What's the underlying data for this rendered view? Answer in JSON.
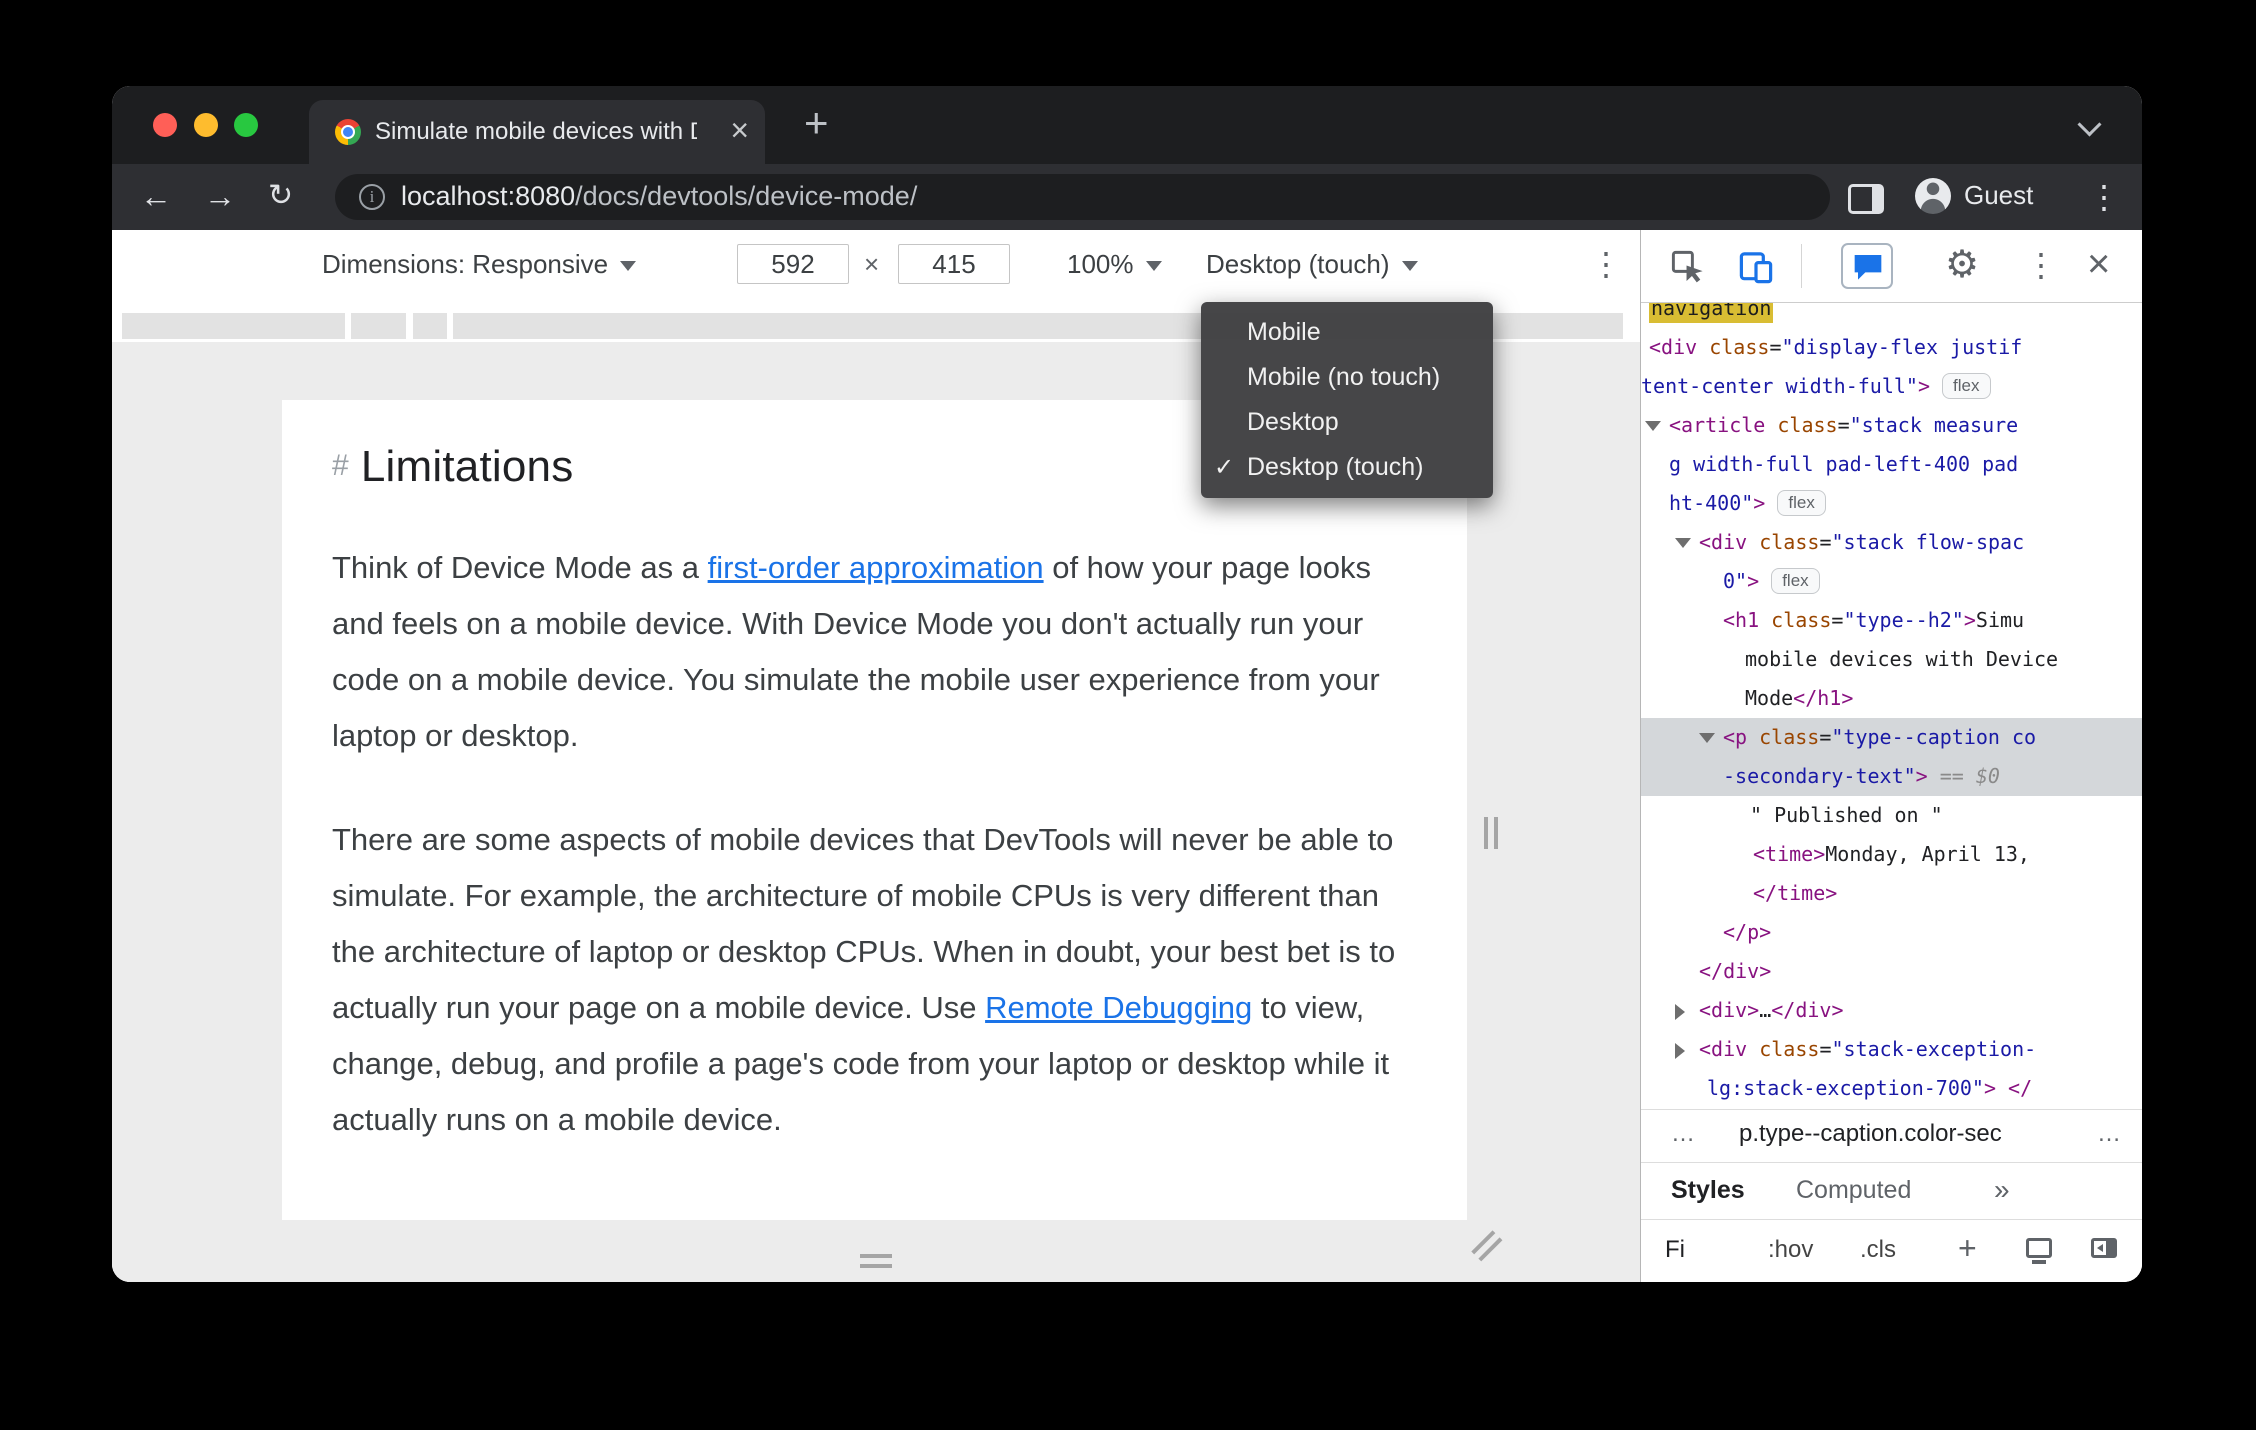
{
  "tabbar": {
    "tab_title": "Simulate mobile devices with D",
    "close_glyph": "×",
    "new_tab_glyph": "+"
  },
  "navbar": {
    "back_glyph": "←",
    "forward_glyph": "→",
    "reload_glyph": "↻",
    "info_glyph": "i",
    "url_host": "localhost:8080",
    "url_path": "/docs/devtools/device-mode/",
    "guest_label": "Guest",
    "menu_glyph": "⋮"
  },
  "device_toolbar": {
    "dimensions_label": "Dimensions: Responsive",
    "width_value": "592",
    "times_glyph": "×",
    "height_value": "415",
    "zoom_value": "100%",
    "device_type_value": "Desktop (touch)",
    "more_glyph": "⋮"
  },
  "device_menu": {
    "check_glyph": "✓",
    "items": [
      {
        "label": "Mobile",
        "checked": false
      },
      {
        "label": "Mobile (no touch)",
        "checked": false
      },
      {
        "label": "Desktop",
        "checked": false
      },
      {
        "label": "Desktop (touch)",
        "checked": true
      }
    ]
  },
  "page": {
    "heading_hash": "#",
    "heading": "Limitations",
    "para1": [
      {
        "t": "Think of Device Mode as a "
      },
      {
        "t": "first-order approximation",
        "link": true
      },
      {
        "t": " of how your page looks and feels on a mobile device. With Device Mode you don't actually run your code on a mobile device. You simulate the mobile user experience from your laptop or desktop."
      }
    ],
    "para2": [
      {
        "t": "There are some aspects of mobile devices that DevTools will never be able to simulate. For example, the architecture of mobile CPUs is very different than the architecture of laptop or desktop CPUs. When in doubt, your best bet is to actually run your page on a mobile device. Use "
      },
      {
        "t": "Remote Debugging",
        "link": true
      },
      {
        "t": " to view, change, debug, and profile a page's code from your laptop or desktop while it actually runs on a mobile device."
      }
    ]
  },
  "devtools": {
    "toolbar": {
      "gear_glyph": "⚙",
      "more_glyph": "⋮",
      "close_glyph": "×"
    },
    "tree": {
      "lines": [
        {
          "pad": 8,
          "clip": true,
          "segments": [
            {
              "t": "navigation",
              "c": "hl"
            }
          ]
        },
        {
          "pad": 8,
          "segments": [
            {
              "t": "<div ",
              "c": "tag"
            },
            {
              "t": "class",
              "c": "attr"
            },
            {
              "t": "=",
              "c": "text"
            },
            {
              "t": "\"display-flex justif",
              "c": "val"
            }
          ]
        },
        {
          "pad": 0,
          "segments": [
            {
              "t": "tent-center width-full\"",
              "c": "val"
            },
            {
              "t": ">",
              "c": "tag"
            },
            {
              "t": " ",
              "c": "text"
            },
            {
              "t": "flex",
              "c": "badge"
            }
          ]
        },
        {
          "pad": 28,
          "arrow": "down",
          "segments": [
            {
              "t": "<article ",
              "c": "tag"
            },
            {
              "t": "class",
              "c": "attr"
            },
            {
              "t": "=",
              "c": "text"
            },
            {
              "t": "\"stack measure",
              "c": "val"
            }
          ]
        },
        {
          "pad": 28,
          "segments": [
            {
              "t": "g width-full pad-left-400 pad",
              "c": "val"
            }
          ]
        },
        {
          "pad": 28,
          "segments": [
            {
              "t": "ht-400\"",
              "c": "val"
            },
            {
              "t": ">",
              "c": "tag"
            },
            {
              "t": " ",
              "c": "text"
            },
            {
              "t": "flex",
              "c": "badge"
            }
          ]
        },
        {
          "pad": 58,
          "arrow": "down",
          "segments": [
            {
              "t": "<div ",
              "c": "tag"
            },
            {
              "t": "class",
              "c": "attr"
            },
            {
              "t": "=",
              "c": "text"
            },
            {
              "t": "\"stack flow-spac",
              "c": "val"
            }
          ]
        },
        {
          "pad": 82,
          "segments": [
            {
              "t": "0\"",
              "c": "val"
            },
            {
              "t": ">",
              "c": "tag"
            },
            {
              "t": " ",
              "c": "text"
            },
            {
              "t": "flex",
              "c": "badge"
            }
          ]
        },
        {
          "pad": 82,
          "segments": [
            {
              "t": "<h1 ",
              "c": "tag"
            },
            {
              "t": "class",
              "c": "attr"
            },
            {
              "t": "=",
              "c": "text"
            },
            {
              "t": "\"type--h2\"",
              "c": "val"
            },
            {
              "t": ">",
              "c": "tag"
            },
            {
              "t": "Simu",
              "c": "text"
            }
          ]
        },
        {
          "pad": 104,
          "segments": [
            {
              "t": "mobile devices with Device",
              "c": "text"
            }
          ]
        },
        {
          "pad": 104,
          "segments": [
            {
              "t": "Mode",
              "c": "text"
            },
            {
              "t": "</h1>",
              "c": "tag"
            }
          ]
        },
        {
          "pad": 82,
          "arrow": "down",
          "selected": true,
          "segments": [
            {
              "t": "<p ",
              "c": "tag"
            },
            {
              "t": "class",
              "c": "attr"
            },
            {
              "t": "=",
              "c": "text"
            },
            {
              "t": "\"type--caption co",
              "c": "val"
            }
          ]
        },
        {
          "pad": 82,
          "selected": true,
          "segments": [
            {
              "t": "-secondary-text\"",
              "c": "val"
            },
            {
              "t": ">",
              "c": "tag"
            },
            {
              "t": " ",
              "c": "text"
            },
            {
              "t": "== ",
              "c": "eq"
            },
            {
              "t": "$0",
              "c": "dol"
            }
          ]
        },
        {
          "pad": 109,
          "segments": [
            {
              "t": "\" Published on \"",
              "c": "text"
            }
          ]
        },
        {
          "pad": 112,
          "segments": [
            {
              "t": "<time>",
              "c": "tag"
            },
            {
              "t": "Monday, April 13,",
              "c": "text"
            }
          ]
        },
        {
          "pad": 112,
          "segments": [
            {
              "t": "</time>",
              "c": "tag"
            }
          ]
        },
        {
          "pad": 82,
          "segments": [
            {
              "t": "</p>",
              "c": "tag"
            }
          ]
        },
        {
          "pad": 58,
          "segments": [
            {
              "t": "</div>",
              "c": "tag"
            }
          ]
        },
        {
          "pad": 58,
          "arrow": "right",
          "segments": [
            {
              "t": "<div>",
              "c": "tag"
            },
            {
              "t": "…",
              "c": "text"
            },
            {
              "t": "</div>",
              "c": "tag"
            }
          ]
        },
        {
          "pad": 58,
          "arrow": "right",
          "segments": [
            {
              "t": "<div ",
              "c": "tag"
            },
            {
              "t": "class",
              "c": "attr"
            },
            {
              "t": "=",
              "c": "text"
            },
            {
              "t": "\"stack-exception-",
              "c": "val"
            }
          ]
        },
        {
          "pad": 66,
          "segments": [
            {
              "t": "lg:stack-exception-700\"",
              "c": "val"
            },
            {
              "t": "> ",
              "c": "tag"
            },
            {
              "t": "</",
              "c": "tag"
            }
          ]
        }
      ]
    },
    "crumbs": {
      "overflow_left": "…",
      "selected": "p.type--caption.color-sec",
      "overflow_right": "…"
    },
    "tabs": {
      "styles": "Styles",
      "computed": "Computed",
      "more": "»"
    },
    "filter": {
      "value": "Fi",
      "hov": ":hov",
      "cls": ".cls",
      "add": "+"
    }
  },
  "colors": {
    "accent_blue": "#1a73e8",
    "tag": "#881280",
    "attr_name": "#994500",
    "attr_value": "#1a1aa6",
    "selection_gray": "#d4d7da"
  }
}
